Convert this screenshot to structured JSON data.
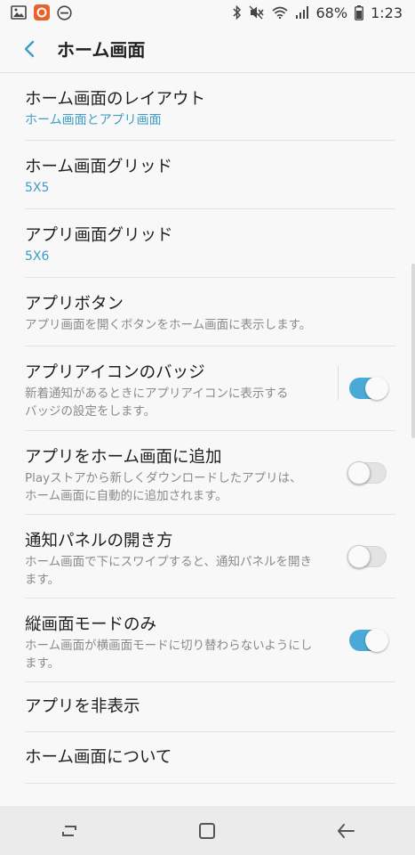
{
  "status_bar": {
    "battery_percent": "68%",
    "time": "1:23",
    "icons": [
      "gallery-icon",
      "app-notification-icon",
      "do-not-disturb-icon",
      "bluetooth-icon",
      "mute-icon",
      "wifi-icon",
      "signal-icon",
      "battery-icon"
    ]
  },
  "header": {
    "title": "ホーム画面"
  },
  "settings": [
    {
      "title": "ホーム画面のレイアウト",
      "value": "ホーム画面とアプリ画面"
    },
    {
      "title": "ホーム画面グリッド",
      "value": "5X5"
    },
    {
      "title": "アプリ画面グリッド",
      "value": "5X6"
    },
    {
      "title": "アプリボタン",
      "subtitle": "アプリ画面を開くボタンをホーム画面に表示します。"
    },
    {
      "title": "アプリアイコンのバッジ",
      "subtitle_1": "新着通知があるときにアプリアイコンに表示する",
      "subtitle_2": "バッジの設定をします。",
      "toggle": "on"
    },
    {
      "title": "アプリをホーム画面に追加",
      "subtitle_1": "Playストアから新しくダウンロードしたアプリは、",
      "subtitle_2": "ホーム画面に自動的に追加されます。",
      "toggle": "off"
    },
    {
      "title": "通知パネルの開き方",
      "subtitle_1": "ホーム画面で下にスワイプすると、通知パネルを開き",
      "subtitle_2": "ます。",
      "toggle": "off"
    },
    {
      "title": "縦画面モードのみ",
      "subtitle_1": "ホーム画面が横画面モードに切り替わらないようにし",
      "subtitle_2": "ます。",
      "toggle": "on"
    },
    {
      "title": "アプリを非表示"
    },
    {
      "title": "ホーム画面について"
    }
  ],
  "colors": {
    "accent": "#4aa9d6",
    "value_text": "#3f9cc7",
    "background": "#f8f8f8"
  },
  "nav_bar": [
    "recent-apps-icon",
    "home-icon",
    "back-icon"
  ]
}
